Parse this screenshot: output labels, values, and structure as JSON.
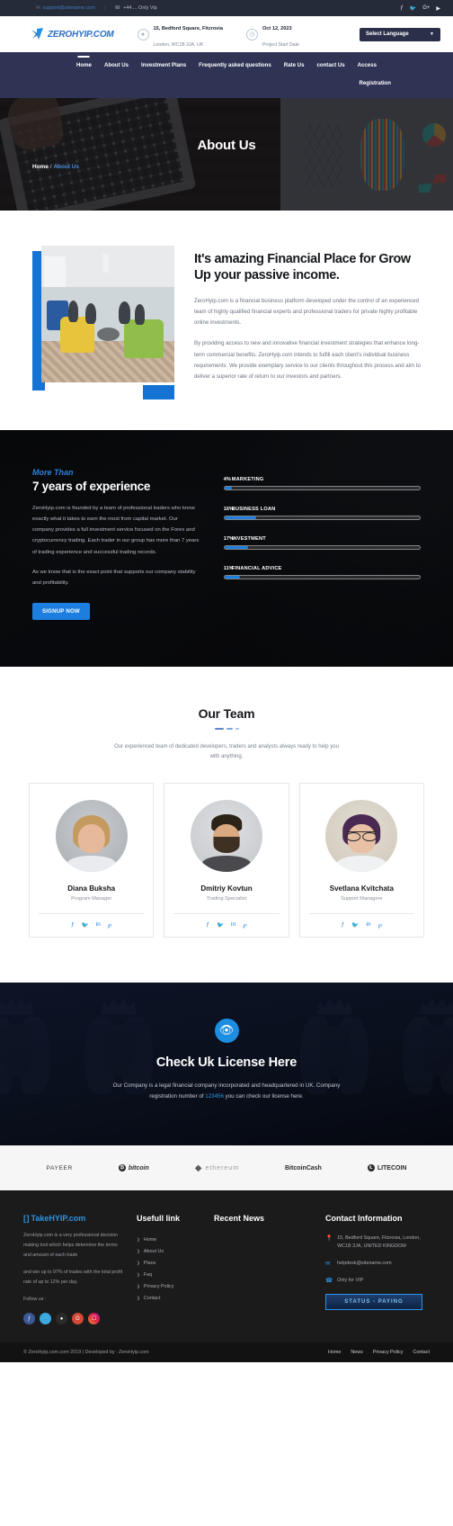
{
  "topbar": {
    "email": "support@sitename.com",
    "phone": "+44.... Only Vip",
    "separator": "|",
    "socials": [
      "facebook-icon",
      "twitter-icon",
      "google-plus-icon",
      "youtube-icon"
    ]
  },
  "header": {
    "logo_text": "ZEROHYIP.COM",
    "address_line1": "15, Bedford Square, Fitzrovia",
    "address_line2": "London, WC1B 3JA, UK",
    "date_line1": "Oct 12, 2023",
    "date_line2": "Project Start Date",
    "language_label": "Select Language"
  },
  "nav": {
    "items": [
      {
        "label": "Home",
        "active": true
      },
      {
        "label": "About Us",
        "active": false
      },
      {
        "label": "Investment Plans",
        "active": false
      },
      {
        "label": "Frequently asked questions",
        "active": false
      },
      {
        "label": "Rate Us",
        "active": false
      },
      {
        "label": "contact Us",
        "active": false
      },
      {
        "label": "Access",
        "active": false
      }
    ],
    "second_row": "Registration"
  },
  "banner": {
    "title": "About Us",
    "crumb_home": "Home",
    "crumb_sep": "/",
    "crumb_current": "About Us"
  },
  "about": {
    "heading": "It's amazing Financial Place for Grow Up your passive income.",
    "paragraph1": "ZeroHyip.com is a financial business platform developed under the control of an experienced team of highly qualified financial experts and professional traders for private highly profitable online investments.",
    "paragraph2": "By providing access to new and innovative financial investment strategies that enhance long-term commercial benefits. ZeroHyip.com intends to fulfill each client's individual business requirements. We provide exemplary service to our clients throughout this process and aim to deliver a superior rate of return to our investors and partners."
  },
  "experience": {
    "kicker": "More Than",
    "heading": "7 years of experience",
    "paragraph1": "ZeroHyip.com is founded by a team of professional traders who know exactly what it takes to earn the most from capital market. Our company provides a full investment service focused on the Forex and cryptocurrency trading. Each trader in our group has more than 7 years of trading experience and successful trading records.",
    "paragraph2": "As we know that is the exact point that supports our company stability and profitability.",
    "button_label": "SIGNUP NOW",
    "skills": [
      {
        "label": "MARKETING",
        "percent": "4%",
        "value": 4
      },
      {
        "label": "BUSINESS LOAN",
        "percent": "16%",
        "value": 16
      },
      {
        "label": "INVESTMENT",
        "percent": "17%",
        "value": 12
      },
      {
        "label": "FINANCIAL ADVICE",
        "percent": "11%",
        "value": 8
      }
    ]
  },
  "team": {
    "heading": "Our Team",
    "subtitle": "Our experienced team of dedicated developers, traders and analysts always ready to help you with anything.",
    "members": [
      {
        "name": "Diana Buksha",
        "role": "Program Manager",
        "socials": [
          "facebook-icon",
          "twitter-icon",
          "linkedin-icon",
          "pinterest-icon"
        ]
      },
      {
        "name": "Dmitriy Kovtun",
        "role": "Trading Specialist",
        "socials": [
          "facebook-icon",
          "twitter-icon",
          "linkedin-icon",
          "pinterest-icon"
        ]
      },
      {
        "name": "Svetlana Kvitchata",
        "role": "Support Managere",
        "socials": [
          "facebook-icon",
          "twitter-icon",
          "linkedin-icon",
          "pinterest-icon"
        ]
      }
    ]
  },
  "license": {
    "heading": "Check Uk License Here",
    "text_before": "Our Company is a legal financial company incorporated and headquartered in UK. Company registration number of ",
    "number": "123456",
    "text_after": " you can check our license here."
  },
  "payments": [
    {
      "name": "PAYEER",
      "icon": "payeer-icon"
    },
    {
      "name": "bitcoin",
      "icon": "bitcoin-icon"
    },
    {
      "name": "ethereum",
      "icon": "ethereum-icon"
    },
    {
      "name": "BitcoinCash",
      "icon": "bitcoincash-icon"
    },
    {
      "name": "LITECOIN",
      "icon": "litecoin-icon"
    }
  ],
  "footer": {
    "brand": "TakeHYIP.com",
    "brand_mark": "[ ]",
    "about_p1": "ZeroHyip.com is a very professional decision making tool which helps determine the terms and amount of each trade",
    "about_p2": "and win up to 97% of trades with the total profit rate of up to 12% per day.",
    "follow_label": "Follow us :",
    "socials": [
      "facebook-icon",
      "twitter-icon",
      "github-icon",
      "google-plus-icon",
      "instagram-icon"
    ],
    "useful_title": "Usefull link",
    "useful_links": [
      "Home",
      "About Us",
      "Plans",
      "Faq",
      "Privacy Policy",
      "Contact"
    ],
    "news_title": "Recent News",
    "contact_title": "Contact Information",
    "contact_address": "15, Bedford Square, Fitzrovia, London, WC1B 3JA, UNITED KINGDOM",
    "contact_email": "helpdesk@sitename.com",
    "contact_vip": "Only for VIP",
    "status_badge": "STATUS - PAYING"
  },
  "bottombar": {
    "copyright": "© ZeroHyip.com.com 2019 | Developed by : ZeroHyip.com",
    "links": [
      "Home",
      "News",
      "Privacy Policy",
      "Contact"
    ]
  }
}
